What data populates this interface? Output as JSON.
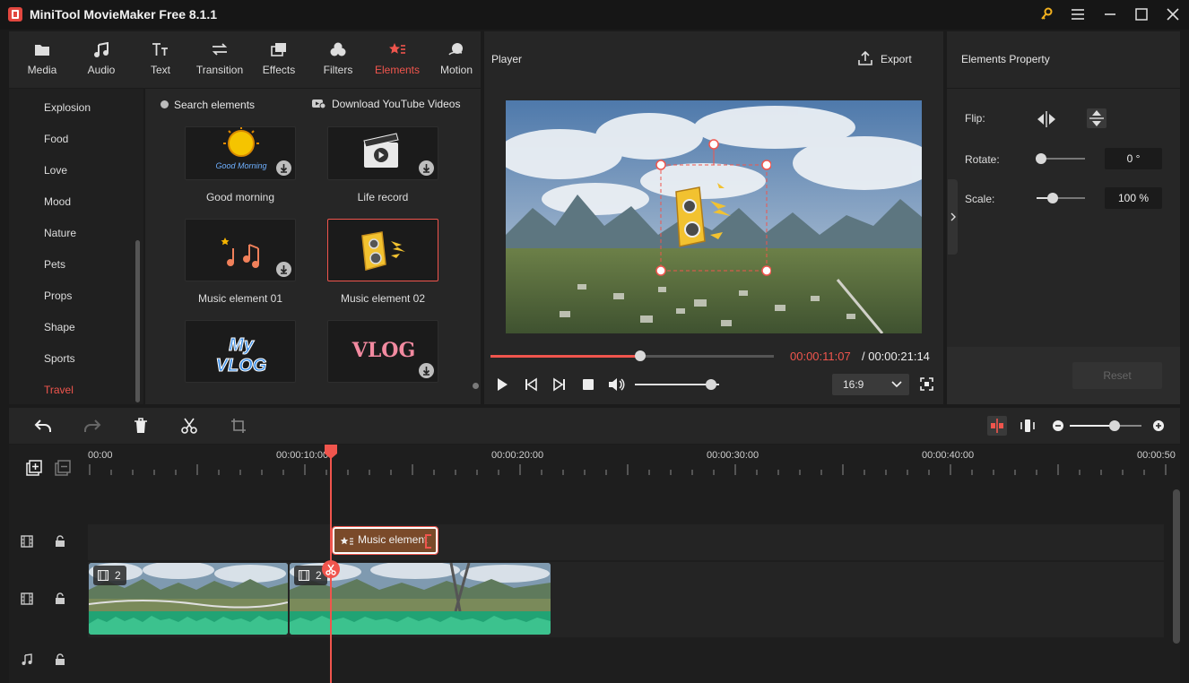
{
  "window": {
    "title": "MiniTool MovieMaker Free 8.1.1"
  },
  "tabs": [
    {
      "label": "Media",
      "icon": "media-icon"
    },
    {
      "label": "Audio",
      "icon": "audio-icon"
    },
    {
      "label": "Text",
      "icon": "text-icon"
    },
    {
      "label": "Transition",
      "icon": "transition-icon"
    },
    {
      "label": "Effects",
      "icon": "effects-icon"
    },
    {
      "label": "Filters",
      "icon": "filters-icon"
    },
    {
      "label": "Elements",
      "icon": "elements-icon",
      "active": true
    },
    {
      "label": "Motion",
      "icon": "motion-icon"
    }
  ],
  "categories": [
    "Explosion",
    "Food",
    "Love",
    "Mood",
    "Nature",
    "Pets",
    "Props",
    "Shape",
    "Sports",
    "Travel"
  ],
  "active_category": "Travel",
  "elements_panel": {
    "search_label": "Search elements",
    "download_label": "Download YouTube Videos",
    "items": [
      {
        "label": "Good morning",
        "thumb_text": "Good Morning"
      },
      {
        "label": "Life record"
      },
      {
        "label": "Music element 01"
      },
      {
        "label": "Music element 02",
        "selected": true
      },
      {
        "label": "",
        "thumb_text": "My VLOG"
      },
      {
        "label": "",
        "thumb_text": "VLOG"
      }
    ]
  },
  "player": {
    "title": "Player",
    "export_label": "Export",
    "current_time": "00:00:11:07",
    "total_time": "/ 00:00:21:14",
    "progress": 0.53,
    "volume": 0.9,
    "aspect_ratio": "16:9"
  },
  "properties": {
    "title": "Elements Property",
    "flip_label": "Flip:",
    "rotate_label": "Rotate:",
    "rotate_value": "0 °",
    "scale_label": "Scale:",
    "scale_value": "100 %",
    "reset_label": "Reset"
  },
  "timeline": {
    "ruler_labels": [
      "00:00",
      "00:00:10:00",
      "00:00:20:00",
      "00:00:30:00",
      "00:00:40:00",
      "00:00:50"
    ],
    "element_clip_label": "Music element",
    "video_clips": [
      {
        "badge": "2"
      },
      {
        "badge": "2"
      }
    ],
    "zoom": 0.62
  },
  "colors": {
    "accent": "#f0554d",
    "audio_wave": "#21a374",
    "panel": "#262626"
  }
}
